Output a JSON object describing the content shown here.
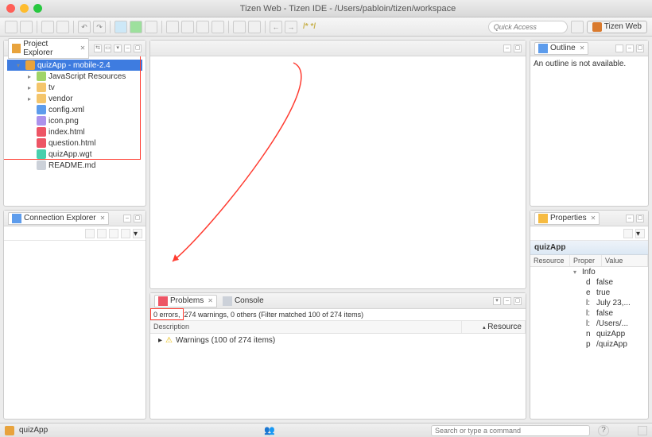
{
  "window": {
    "title": "Tizen Web - Tizen IDE - /Users/pabloin/tizen/workspace"
  },
  "toolbar": {
    "quick_placeholder": "Quick Access",
    "perspective": "Tizen Web"
  },
  "project_explorer": {
    "title": "Project Explorer",
    "root": "quizApp - mobile-2.4",
    "items": [
      {
        "label": "JavaScript Resources",
        "icon": "ico-js"
      },
      {
        "label": "tv",
        "icon": "ico-folder"
      },
      {
        "label": "vendor",
        "icon": "ico-folder"
      },
      {
        "label": "config.xml",
        "icon": "ico-xml"
      },
      {
        "label": "icon.png",
        "icon": "ico-img"
      },
      {
        "label": "index.html",
        "icon": "ico-html"
      },
      {
        "label": "question.html",
        "icon": "ico-html"
      },
      {
        "label": "quizApp.wgt",
        "icon": "ico-wgt"
      },
      {
        "label": "README.md",
        "icon": "ico-txt"
      }
    ]
  },
  "connection_explorer": {
    "title": "Connection Explorer"
  },
  "outline": {
    "title": "Outline",
    "empty": "An outline is not available."
  },
  "properties": {
    "title": "Properties",
    "subject": "quizApp",
    "cols": {
      "resource": "Resource",
      "property": "Proper",
      "value": "Value"
    },
    "group": "Info",
    "rows": [
      {
        "p": "d",
        "v": "false"
      },
      {
        "p": "e",
        "v": "true"
      },
      {
        "p": "l:",
        "v": "July 23,..."
      },
      {
        "p": "l:",
        "v": "false"
      },
      {
        "p": "l:",
        "v": "/Users/..."
      },
      {
        "p": "n",
        "v": "quizApp"
      },
      {
        "p": "p",
        "v": "/quizApp"
      }
    ]
  },
  "problems": {
    "tab_problems": "Problems",
    "tab_console": "Console",
    "summary_errors": "0 errors,",
    "summary_rest": "274 warnings, 0 others (Filter matched 100 of 274 items)",
    "col_desc": "Description",
    "col_res": "Resource",
    "warn_row": "Warnings (100 of 274 items)"
  },
  "status": {
    "project": "quizApp",
    "search_placeholder": "Search or type a command"
  }
}
